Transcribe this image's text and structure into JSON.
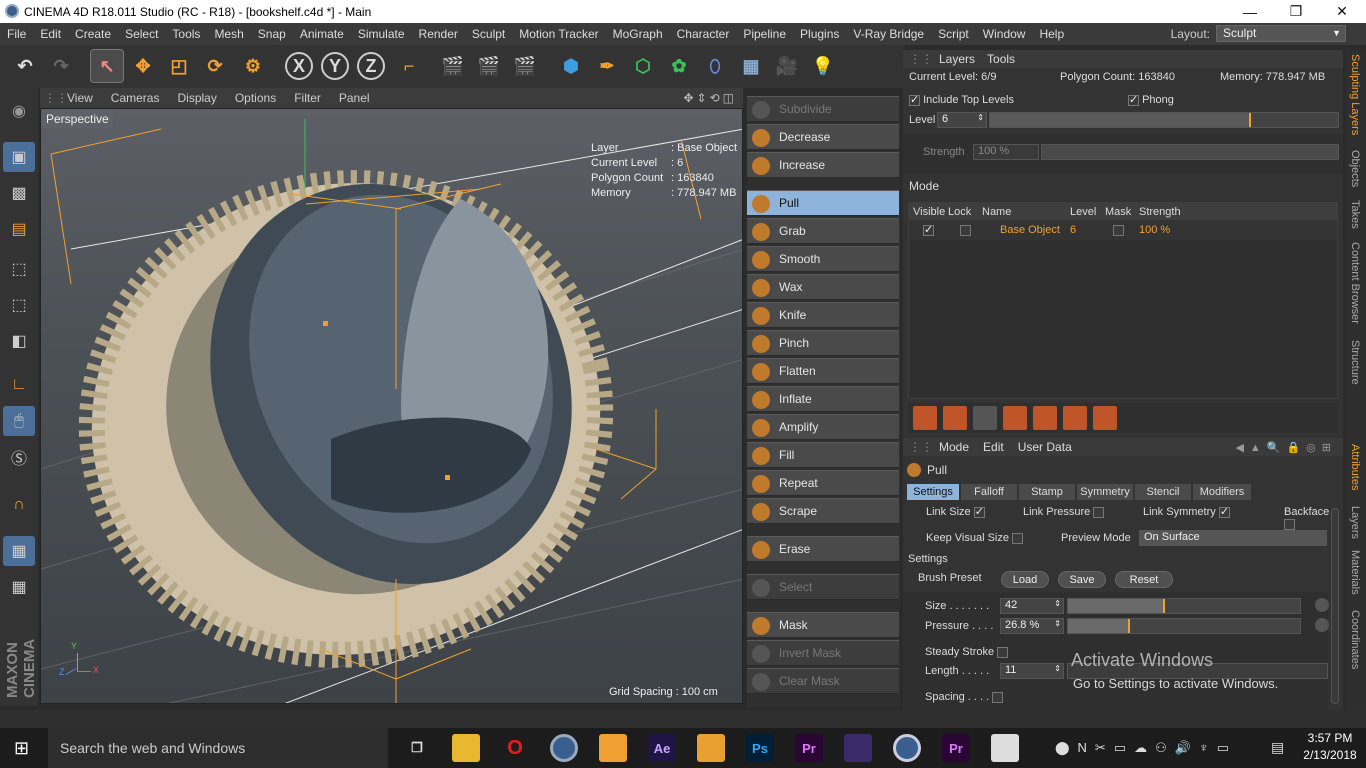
{
  "window": {
    "title": "CINEMA 4D R18.011 Studio (RC - R18) - [bookshelf.c4d *] - Main",
    "min": "—",
    "max": "❐",
    "close": "✕"
  },
  "menu": [
    "File",
    "Edit",
    "Create",
    "Select",
    "Tools",
    "Mesh",
    "Snap",
    "Animate",
    "Simulate",
    "Render",
    "Sculpt",
    "Motion Tracker",
    "MoGraph",
    "Character",
    "Pipeline",
    "Plugins",
    "V-Ray Bridge",
    "Script",
    "Window",
    "Help"
  ],
  "layout": {
    "label": "Layout:",
    "value": "Sculpt"
  },
  "toolbar": {
    "x_label": "X",
    "y_label": "Y",
    "z_label": "Z"
  },
  "viewport": {
    "menu": [
      "View",
      "Cameras",
      "Display",
      "Options",
      "Filter",
      "Panel"
    ],
    "name": "Perspective",
    "hud": [
      {
        "key": "Layer",
        "value": ": Base Object"
      },
      {
        "key": "Current Level",
        "value": ": 6"
      },
      {
        "key": "Polygon Count",
        "value": ": 163840"
      },
      {
        "key": "Memory",
        "value": ": 778.947 MB"
      }
    ],
    "grid_spacing": "Grid Spacing : 100 cm",
    "axis_y": "Y",
    "axis_x": "X",
    "axis_z": "Z",
    "brand": "MAXON CINEMA 4D"
  },
  "brushes": [
    {
      "label": "Subdivide",
      "state": "dim"
    },
    {
      "label": "Decrease",
      "state": "normal"
    },
    {
      "label": "Increase",
      "state": "normal"
    },
    {
      "label": "Pull",
      "state": "active"
    },
    {
      "label": "Grab",
      "state": "normal"
    },
    {
      "label": "Smooth",
      "state": "normal"
    },
    {
      "label": "Wax",
      "state": "normal"
    },
    {
      "label": "Knife",
      "state": "normal"
    },
    {
      "label": "Pinch",
      "state": "normal"
    },
    {
      "label": "Flatten",
      "state": "normal"
    },
    {
      "label": "Inflate",
      "state": "normal"
    },
    {
      "label": "Amplify",
      "state": "normal"
    },
    {
      "label": "Fill",
      "state": "normal"
    },
    {
      "label": "Repeat",
      "state": "normal"
    },
    {
      "label": "Scrape",
      "state": "normal"
    },
    {
      "label": "Erase",
      "state": "normal"
    },
    {
      "label": "Select",
      "state": "dim"
    },
    {
      "label": "Mask",
      "state": "normal"
    },
    {
      "label": "Invert Mask",
      "state": "dim"
    },
    {
      "label": "Clear Mask",
      "state": "dim"
    }
  ],
  "layers": {
    "tabs": [
      "Layers",
      "Tools"
    ],
    "current_level": "Current Level: 6/9",
    "polygon_count": "Polygon Count: 163840",
    "memory": "Memory: 778.947 MB",
    "include_top": "Include Top Levels",
    "phong": "Phong",
    "level_label": "Level",
    "level_value": "6",
    "level_fraction": 0.75,
    "strength_label": "Strength",
    "strength_value": "100 %",
    "mode_label": "Mode",
    "columns": [
      "Visible",
      "Lock",
      "Name",
      "Level",
      "Mask",
      "Strength"
    ],
    "row": {
      "name": "Base Object",
      "level": "6",
      "strength": "100 %"
    }
  },
  "attributes": {
    "menu": [
      "Mode",
      "Edit",
      "User Data"
    ],
    "tool_name": "Pull",
    "tabs": [
      "Settings",
      "Falloff",
      "Stamp",
      "Symmetry",
      "Stencil",
      "Modifiers"
    ],
    "link_size": "Link Size",
    "link_pressure": "Link Pressure",
    "link_symmetry": "Link Symmetry",
    "backface": "Backface",
    "keep_visual_size": "Keep Visual Size",
    "preview_mode_label": "Preview Mode",
    "preview_mode_value": "On Surface",
    "settings_header": "Settings",
    "brush_preset": "Brush Preset",
    "load": "Load",
    "save": "Save",
    "reset": "Reset",
    "size_label": "Size . . . . . . .",
    "size_value": "42",
    "size_fraction": 0.42,
    "pressure_label": "Pressure . . . .",
    "pressure_value": "26.8 %",
    "pressure_fraction": 0.268,
    "steady_stroke": "Steady Stroke",
    "length_label": "Length . . . . .",
    "length_value": "11",
    "spacing_label": "Spacing . . . .",
    "watermark_title": "Activate Windows",
    "watermark_sub": "Go to Settings to activate Windows."
  },
  "side_tabs_top": [
    "Sculpting Layers",
    "Objects",
    "Takes",
    "Content Browser",
    "Structure"
  ],
  "side_tabs_bottom": [
    "Attributes",
    "Layers",
    "Materials",
    "Coordinates"
  ],
  "taskbar": {
    "search": "Search the web and Windows",
    "time": "3:57 PM",
    "date": "2/13/2018",
    "apps": [
      "Ae",
      "Ps",
      "Pr",
      "Pr"
    ]
  }
}
